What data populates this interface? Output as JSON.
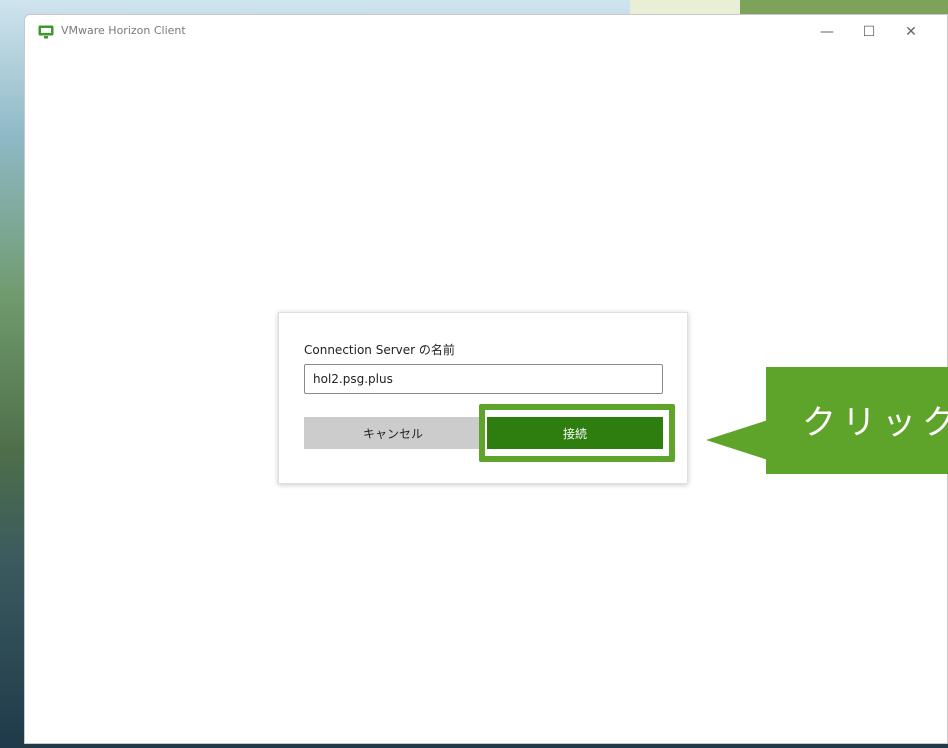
{
  "window": {
    "title": "VMware Horizon Client",
    "controls": {
      "minimize": "—",
      "maximize": "☐",
      "close": "✕"
    }
  },
  "dialog": {
    "label": "Connection Server の名前",
    "server_input_value": "hol2.psg.plus",
    "cancel_label": "キャンセル",
    "connect_label": "接続"
  },
  "callout": {
    "text": "クリック"
  },
  "colors": {
    "accent_green": "#5fa42a",
    "connect_button": "#2e7d0f",
    "cancel_button": "#cccccc"
  },
  "icons": {
    "app": "horizon-client-icon"
  }
}
